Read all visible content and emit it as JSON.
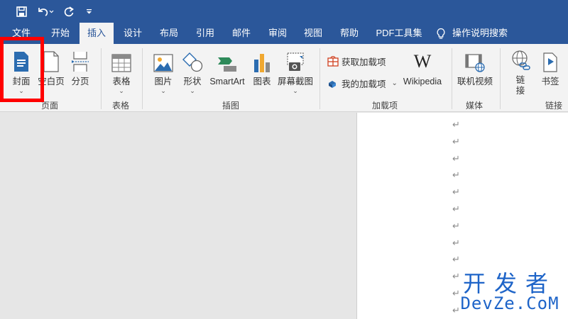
{
  "quick_access": {
    "save_icon": "save-icon",
    "undo_icon": "undo-icon",
    "redo_icon": "redo-icon",
    "customize_icon": "customize-icon"
  },
  "tabs": [
    {
      "label": "文件",
      "active": false
    },
    {
      "label": "开始",
      "active": false
    },
    {
      "label": "插入",
      "active": true
    },
    {
      "label": "设计",
      "active": false
    },
    {
      "label": "布局",
      "active": false
    },
    {
      "label": "引用",
      "active": false
    },
    {
      "label": "邮件",
      "active": false
    },
    {
      "label": "审阅",
      "active": false
    },
    {
      "label": "视图",
      "active": false
    },
    {
      "label": "帮助",
      "active": false
    },
    {
      "label": "PDF工具集",
      "active": false
    },
    {
      "label": "操作说明搜索",
      "active": false
    }
  ],
  "ribbon": {
    "pages_group": {
      "label": "页面",
      "cover": "封面",
      "blank_page": "空白页",
      "page_break": "分页"
    },
    "tables_group": {
      "label": "表格",
      "table": "表格"
    },
    "illustrations_group": {
      "label": "插图",
      "picture": "图片",
      "shapes": "形状",
      "smartart": "SmartArt",
      "chart": "图表",
      "screenshot": "屏幕截图"
    },
    "addins_group": {
      "label": "加载项",
      "get_addins": "获取加载项",
      "my_addins": "我的加载项",
      "wikipedia": "Wikipedia",
      "wikipedia_glyph": "W"
    },
    "media_group": {
      "label": "媒体",
      "online_video": "联机视频"
    },
    "links_group": {
      "label": "链接",
      "link": "链接",
      "bookmark": "书签"
    }
  },
  "document": {
    "paragraph_mark": "↵",
    "paragraph_count": 12
  },
  "watermark": {
    "line1": "开发者",
    "line2": "DevZe.CoM"
  },
  "colors": {
    "title_bar": "#2b579a",
    "ribbon": "#f3f3f3",
    "highlight": "#ff0000"
  }
}
